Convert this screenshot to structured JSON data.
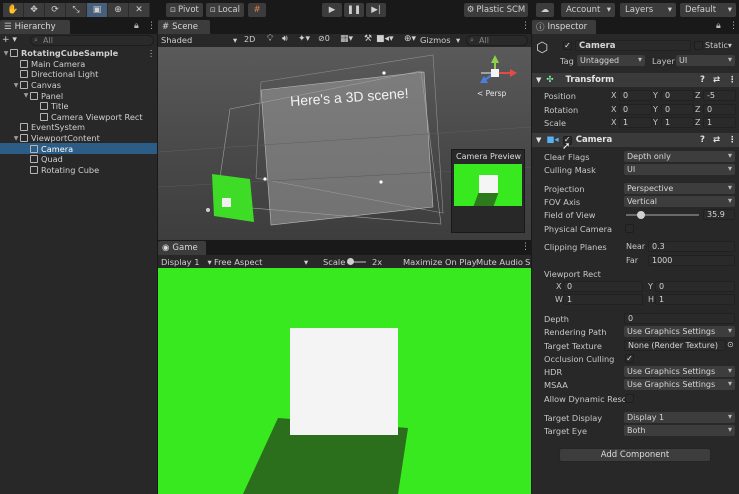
{
  "toolbar": {
    "pivot_label": "Pivot",
    "local_label": "Local",
    "plastic_label": "Plastic SCM",
    "account_label": "Account",
    "layers_label": "Layers",
    "layout_label": "Default"
  },
  "hierarchy": {
    "tab_label": "Hierarchy",
    "add_label": "+ ▾",
    "search_placeholder": "All",
    "items": [
      {
        "label": "RotatingCubeSample",
        "depth": 0,
        "expanded": true,
        "bold": true
      },
      {
        "label": "Main Camera",
        "depth": 1
      },
      {
        "label": "Directional Light",
        "depth": 1
      },
      {
        "label": "Canvas",
        "depth": 1,
        "expanded": true
      },
      {
        "label": "Panel",
        "depth": 2,
        "expanded": true
      },
      {
        "label": "Title",
        "depth": 3
      },
      {
        "label": "Camera Viewport Rect",
        "depth": 3
      },
      {
        "label": "EventSystem",
        "depth": 1
      },
      {
        "label": "ViewportContent",
        "depth": 1,
        "expanded": true
      },
      {
        "label": "Camera",
        "depth": 2,
        "selected": true
      },
      {
        "label": "Quad",
        "depth": 2
      },
      {
        "label": "Rotating Cube",
        "depth": 2
      }
    ]
  },
  "scene": {
    "tab_label": "Scene",
    "shading_mode": "Shaded",
    "mode_2d": "2D",
    "hidden_count": "0",
    "gizmos_label": "Gizmos",
    "search_placeholder": "All",
    "canvas_text": "Here's a 3D scene!",
    "persp_label": "< Persp",
    "camera_preview_label": "Camera Preview"
  },
  "game": {
    "tab_label": "Game",
    "display_label": "Display 1",
    "aspect_label": "Free Aspect",
    "scale_label": "Scale",
    "scale_value": "2x",
    "maximize_label": "Maximize On Play",
    "mute_label": "Mute Audio",
    "stats_label": "S",
    "scale_level": 0.1
  },
  "inspector": {
    "tab_label": "Inspector",
    "object_name": "Camera",
    "static_label": "Static",
    "tag_label": "Tag",
    "tag_value": "Untagged",
    "layer_label": "Layer",
    "layer_value": "UI",
    "transform": {
      "title": "Transform",
      "position_label": "Position",
      "rotation_label": "Rotation",
      "scale_label": "Scale",
      "position": {
        "x": "0",
        "y": "0",
        "z": "-5"
      },
      "rotation": {
        "x": "0",
        "y": "0",
        "z": "0"
      },
      "scale": {
        "x": "1",
        "y": "1",
        "z": "1"
      }
    },
    "camera": {
      "title": "Camera",
      "clear_flags_label": "Clear Flags",
      "clear_flags_value": "Depth only",
      "culling_mask_label": "Culling Mask",
      "culling_mask_value": "UI",
      "projection_label": "Projection",
      "projection_value": "Perspective",
      "fov_axis_label": "FOV Axis",
      "fov_axis_value": "Vertical",
      "fov_label": "Field of View",
      "fov_value": "35.9",
      "fov_min": 1e-05,
      "fov_max": 179,
      "physical_label": "Physical Camera",
      "clipping_label": "Clipping Planes",
      "near_label": "Near",
      "near_value": "0.3",
      "far_label": "Far",
      "far_value": "1000",
      "viewport_label": "Viewport Rect",
      "vp_x_label": "X",
      "vp_x": "0",
      "vp_y_label": "Y",
      "vp_y": "0",
      "vp_w_label": "W",
      "vp_w": "1",
      "vp_h_label": "H",
      "vp_h": "1",
      "depth_label": "Depth",
      "depth_value": "0",
      "rendering_path_label": "Rendering Path",
      "rendering_path_value": "Use Graphics Settings",
      "target_texture_label": "Target Texture",
      "target_texture_value": "None (Render Texture)",
      "occlusion_label": "Occlusion Culling",
      "hdr_label": "HDR",
      "hdr_value": "Use Graphics Settings",
      "msaa_label": "MSAA",
      "msaa_value": "Use Graphics Settings",
      "dynamic_res_label": "Allow Dynamic Resol",
      "target_display_label": "Target Display",
      "target_display_value": "Display 1",
      "target_eye_label": "Target Eye",
      "target_eye_value": "Both"
    },
    "add_component_label": "Add Component"
  },
  "colors": {
    "selection": "#2c5d87",
    "game_background": "#37e91e",
    "panel_bg": "#282828",
    "header_bg": "#3a3a3a"
  }
}
